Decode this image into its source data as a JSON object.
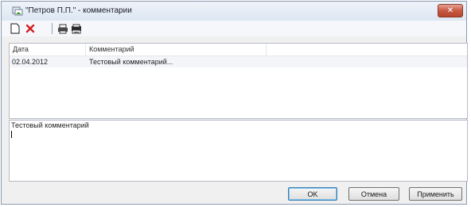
{
  "window": {
    "title": "\"Петров П.П.\" - комментарии",
    "close_label": "✕"
  },
  "toolbar": {
    "icons": [
      "new-document-icon",
      "delete-icon",
      "print-icon",
      "print-preview-icon"
    ]
  },
  "list": {
    "columns": [
      "Дата",
      "Комментарий"
    ],
    "rows": [
      {
        "date": "02.04.2012",
        "comment": "Тестовый комментарий..."
      }
    ]
  },
  "editor": {
    "value": "Тестовый комментарий"
  },
  "buttons": {
    "ok": "OK",
    "cancel": "Отмена",
    "apply": "Применить"
  },
  "colors": {
    "close_button": "#c75a42",
    "delete_icon": "#d42020",
    "window_bg": "#f0f0f0"
  }
}
